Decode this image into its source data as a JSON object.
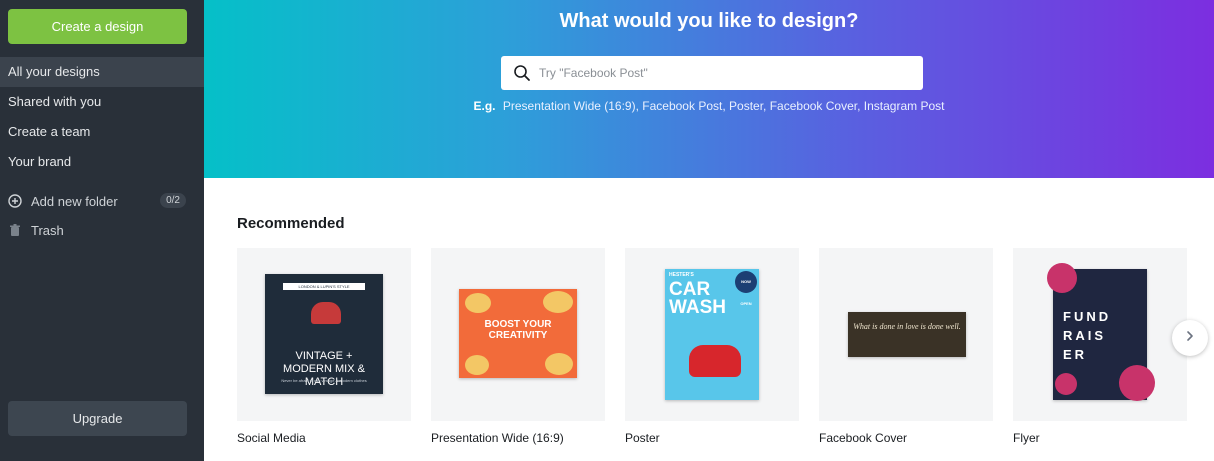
{
  "sidebar": {
    "create_label": "Create a design",
    "nav": [
      {
        "label": "All your designs",
        "active": true
      },
      {
        "label": "Shared with you"
      },
      {
        "label": "Create a team"
      },
      {
        "label": "Your brand"
      }
    ],
    "add_folder_label": "Add new folder",
    "folder_count": "0/2",
    "trash_label": "Trash",
    "upgrade_label": "Upgrade"
  },
  "hero": {
    "title": "What would you like to design?",
    "search_placeholder": "Try \"Facebook Post\"",
    "examples_prefix": "E.g.",
    "examples": [
      "Presentation Wide (16:9),",
      "Facebook Post,",
      "Poster,",
      "Facebook Cover,",
      "Instagram Post"
    ]
  },
  "recommended": {
    "title": "Recommended",
    "cards": [
      {
        "caption": "Social Media",
        "thumb_band": "LONDON & LUPIN'S STYLE",
        "thumb_text": "VINTAGE + MODERN MIX & MATCH",
        "thumb_small": "Never be afraid to mix vintage & modern clothes"
      },
      {
        "caption": "Presentation Wide (16:9)",
        "thumb_text": "BOOST YOUR CREATIVITY"
      },
      {
        "caption": "Poster",
        "thumb_text": "CAR WASH",
        "thumb_badge": "NOW OPEN",
        "thumb_header": "HESTER'S"
      },
      {
        "caption": "Facebook Cover",
        "thumb_text": "What is done in love is done well."
      },
      {
        "caption": "Flyer",
        "thumb_text": "FUND RAIS ER"
      }
    ]
  },
  "colors": {
    "sidebar_bg": "#293039",
    "create_green": "#7dc242",
    "hero_gradient_start": "#05c0c8",
    "hero_gradient_end": "#7c2ee0"
  },
  "icons": {
    "search": "search-icon",
    "add_folder": "plus-circle-icon",
    "trash": "trash-icon",
    "next": "chevron-right-icon"
  }
}
